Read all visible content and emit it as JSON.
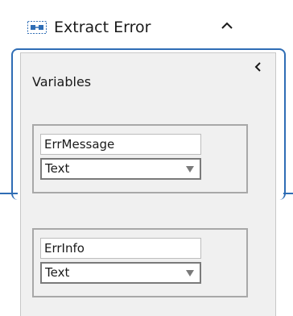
{
  "activity": {
    "title": "Extract Error",
    "icon": "sequence-activity-icon",
    "collapse_icon": "chevron-up-icon",
    "accent_color": "#2f6db5"
  },
  "variables_panel": {
    "title": "Variables",
    "collapse_icon": "chevron-left-icon",
    "variables": [
      {
        "name": "ErrMessage",
        "type": "Text"
      },
      {
        "name": "ErrInfo",
        "type": "Text"
      }
    ]
  }
}
